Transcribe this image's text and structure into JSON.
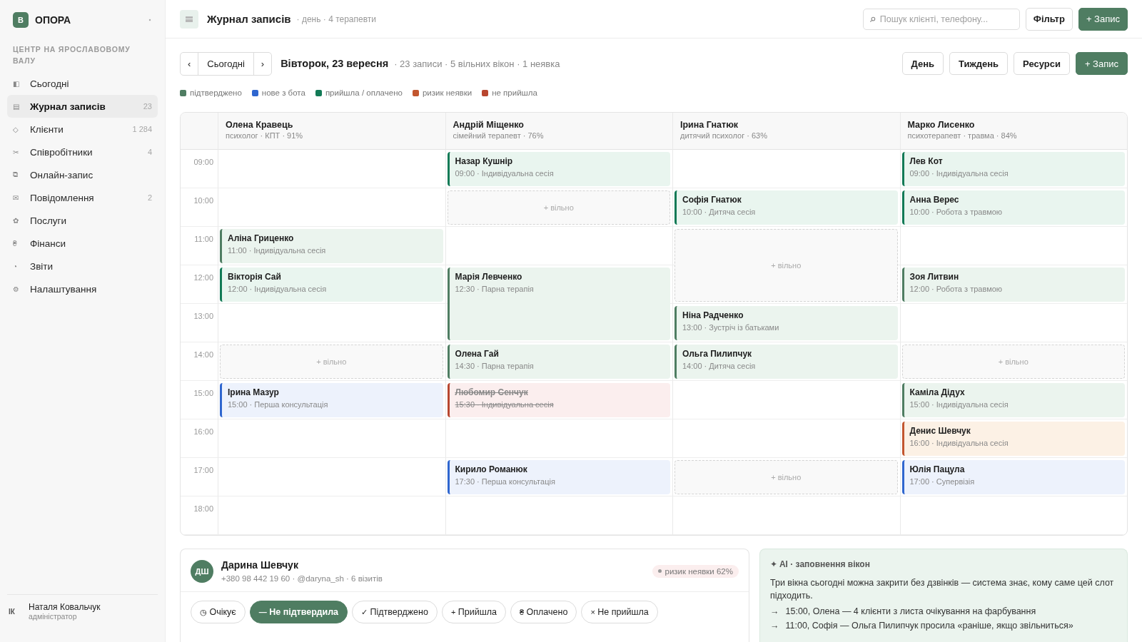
{
  "brand": {
    "logo": "В",
    "name": "ОПОРА"
  },
  "sidebar": {
    "section": "ЦЕНТР НА ЯРОСЛАВОВОМУ ВАЛУ",
    "items": [
      {
        "icon": "◧",
        "label": "Сьогодні",
        "selected": false
      },
      {
        "icon": "▤",
        "label": "Журнал записів",
        "count": "23",
        "selected": true
      },
      {
        "icon": "◇",
        "label": "Клієнти",
        "count": "1 284",
        "selected": false
      },
      {
        "icon": "✂",
        "label": "Співробітники",
        "count": "4",
        "selected": false
      },
      {
        "icon": "⧉",
        "label": "Онлайн-запис",
        "selected": false
      },
      {
        "icon": "✉",
        "label": "Повідомлення",
        "count": "2",
        "selected": false
      },
      {
        "icon": "✿",
        "label": "Послуги",
        "selected": false
      },
      {
        "icon": "₴",
        "label": "Фінанси",
        "selected": false
      },
      {
        "icon": "◔",
        "label": "Звіти",
        "selected": false
      },
      {
        "icon": "⚙",
        "label": "Налаштування",
        "selected": false
      }
    ],
    "user": {
      "initials": "ІК",
      "name": "Наталя Ковальчук",
      "role": "адміністратор"
    }
  },
  "header": {
    "title": "Журнал записів",
    "subtitle": "· день · 4 терапевти",
    "search": {
      "placeholder": "Пошук клієнті, телефону..."
    },
    "filter": "Фільтр",
    "add": "+ Запис"
  },
  "toolbar": {
    "prev": "‹",
    "today": "Сьогодні",
    "next": "›",
    "date": "Вівторок, 23 вересня",
    "summary": "· 23 записи · 5 вільних вікон · 1 неявка",
    "views": [
      {
        "label": "День"
      },
      {
        "label": "Тиждень"
      },
      {
        "label": "Ресурси"
      }
    ],
    "add": "+ Запис"
  },
  "legend": [
    {
      "label": "підтверджено",
      "color": "#4f7d62"
    },
    {
      "label": "нове з бота",
      "color": "#2f66cf"
    },
    {
      "label": "прийшла / оплачено",
      "color": "#127a56"
    },
    {
      "label": "ризик неявки",
      "color": "#c2562f"
    },
    {
      "label": "не прийшла",
      "color": "#b8462f"
    }
  ],
  "schedule": {
    "hours": [
      "09:00",
      "10:00",
      "11:00",
      "12:00",
      "13:00",
      "14:00",
      "15:00",
      "16:00",
      "17:00",
      "18:00"
    ],
    "therapists": [
      {
        "name": "Олена Кравець",
        "info": "психолог · КПТ · 91%",
        "slots": [
          {
            "kind": "empty"
          },
          {
            "kind": "empty"
          },
          {
            "kind": "confirmed",
            "name": "Аліна Гриценко",
            "detail": "11:00 · Індивідуальна сесія"
          },
          {
            "kind": "arrived",
            "name": "Вікторія Сай",
            "detail": "12:00 · Індивідуальна сесія"
          },
          {
            "kind": "empty"
          },
          {
            "kind": "free",
            "label": "+ вільно"
          },
          {
            "kind": "bot",
            "name": "Ірина Мазур",
            "detail": "15:00 · Перша консультація"
          },
          {
            "kind": "empty"
          },
          {
            "kind": "empty"
          },
          {
            "kind": "empty"
          }
        ]
      },
      {
        "name": "Андрій Міщенко",
        "info": "сімейний терапевт · 76%",
        "slots": [
          {
            "kind": "arrived",
            "name": "Назар Кушнір",
            "detail": "09:00 · Індивідуальна сесія"
          },
          {
            "kind": "free",
            "label": "+ вільно"
          },
          {
            "kind": "empty"
          },
          {
            "kind": "confirmed",
            "long": true,
            "name": "Марія Левченко",
            "detail": "12:30 · Парна терапія"
          },
          {
            "kind": "confirmed",
            "name": "Олена Гай",
            "detail": "14:30 · Парна терапія"
          },
          {
            "kind": "noshow",
            "name": "Любомир Сенчук",
            "detail": "15:30 · Індивідуальна сесія"
          },
          {
            "kind": "empty"
          },
          {
            "kind": "bot",
            "name": "Кирило Романюк",
            "detail": "17:30 · Перша консультація"
          },
          {
            "kind": "empty"
          }
        ]
      },
      {
        "name": "Ірина Гнатюк",
        "info": "дитячий психолог · 63%",
        "slots": [
          {
            "kind": "empty"
          },
          {
            "kind": "arrived",
            "name": "Софія Гнатюк",
            "detail": "10:00 · Дитяча сесія"
          },
          {
            "kind": "free",
            "long": true,
            "label": "+ вільно"
          },
          {
            "kind": "confirmed",
            "name": "Ніна Радченко",
            "detail": "13:00 · Зустріч із батьками"
          },
          {
            "kind": "confirmed",
            "name": "Ольга Пилипчук",
            "detail": "14:00 · Дитяча сесія"
          },
          {
            "kind": "empty"
          },
          {
            "kind": "empty"
          },
          {
            "kind": "free",
            "label": "+ вільно"
          },
          {
            "kind": "empty"
          }
        ]
      },
      {
        "name": "Марко Лисенко",
        "info": "психотерапевт · травма · 84%",
        "slots": [
          {
            "kind": "arrived",
            "name": "Лев Кот",
            "detail": "09:00 · Індивідуальна сесія"
          },
          {
            "kind": "arrived",
            "name": "Анна Верес",
            "detail": "10:00 · Робота з травмою"
          },
          {
            "kind": "empty"
          },
          {
            "kind": "confirmed",
            "name": "Зоя Литвин",
            "detail": "12:00 · Робота з травмою"
          },
          {
            "kind": "empty"
          },
          {
            "kind": "free",
            "label": "+ вільно"
          },
          {
            "kind": "confirmed",
            "name": "Каміла Дідух",
            "detail": "15:00 · Індивідуальна сесія"
          },
          {
            "kind": "risk",
            "name": "Денис Шевчук",
            "detail": "16:00 · Індивідуальна сесія"
          },
          {
            "kind": "bot",
            "name": "Юлія Пацула",
            "detail": "17:00 · Супервізія"
          },
          {
            "kind": "empty"
          }
        ]
      }
    ]
  },
  "client": {
    "initials": "ДШ",
    "name": "Дарина Шевчук",
    "contacts": "+380 98 442 19 60 · @daryna_sh · 6 візитів",
    "badge": "ризик неявки 62%",
    "statuses": [
      {
        "icon": "◷",
        "label": "Очікує",
        "selected": false
      },
      {
        "icon": "—",
        "label": "Не підтвердила",
        "selected": true
      },
      {
        "icon": "✓",
        "label": "Підтверджено",
        "selected": false
      },
      {
        "icon": "+",
        "label": "Прийшла",
        "selected": false
      },
      {
        "icon": "₴",
        "label": "Оплачено",
        "selected": false
      },
      {
        "icon": "×",
        "label": "Не прийшла",
        "selected": false
      }
    ]
  },
  "ai": {
    "title": "✦ AI · заповнення вікон",
    "text": "Три вікна сьогодні можна закрити без дзвінків — система знає, кому саме цей слот підходить.",
    "suggestions": [
      {
        "arrow": "→",
        "text": "15:00, Олена — 4 клієнти з листа очікування на фарбування"
      },
      {
        "arrow": "→",
        "text": "11:00, Софія — Ольга Пилипчук просила «раніше, якщо звільниться»"
      }
    ]
  }
}
